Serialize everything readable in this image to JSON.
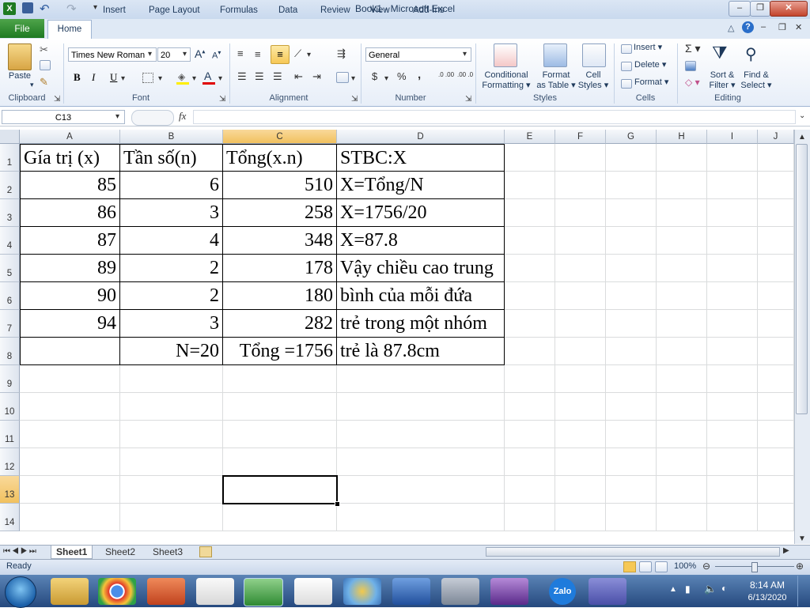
{
  "window": {
    "title": "Book1  -  Microsoft Excel"
  },
  "quick_access": {
    "undo_label": "↶",
    "redo_label": "↷"
  },
  "tabs": [
    "Home",
    "Insert",
    "Page Layout",
    "Formulas",
    "Data",
    "Review",
    "View",
    "Add-Ins"
  ],
  "file_tab": "File",
  "ribbon": {
    "clipboard": {
      "label": "Clipboard",
      "paste": "Paste"
    },
    "font": {
      "label": "Font",
      "name": "Times New Roman",
      "size": "20",
      "bold": "B",
      "italic": "I",
      "underline": "U"
    },
    "alignment": {
      "label": "Alignment"
    },
    "number": {
      "label": "Number",
      "format": "General",
      "currency": "$",
      "percent": "%",
      "comma": ",",
      "inc_decimal": ".0 .00",
      "dec_decimal": ".00 .0"
    },
    "styles": {
      "label": "Styles",
      "conditional": "Conditional\nFormatting",
      "conditional_1": "Conditional",
      "conditional_2": "Formatting",
      "format_table_1": "Format",
      "format_table_2": "as Table",
      "cell_styles_1": "Cell",
      "cell_styles_2": "Styles"
    },
    "cells": {
      "label": "Cells",
      "insert": "Insert",
      "delete": "Delete",
      "format": "Format"
    },
    "editing": {
      "label": "Editing",
      "sort_1": "Sort &",
      "sort_2": "Filter",
      "find_1": "Find &",
      "find_2": "Select"
    }
  },
  "formula_bar": {
    "name_box": "C13",
    "fx": "fx",
    "content": ""
  },
  "columns": [
    "A",
    "B",
    "C",
    "D",
    "E",
    "F",
    "G",
    "H",
    "I",
    "J"
  ],
  "rows": [
    "1",
    "2",
    "3",
    "4",
    "5",
    "6",
    "7",
    "8",
    "9",
    "10",
    "11",
    "12",
    "13",
    "14"
  ],
  "sheet": {
    "r1": [
      "Gía trị (x)",
      "Tần số(n)",
      "Tổng(x.n)",
      "STBC:X"
    ],
    "r2": [
      "85",
      "6",
      "510",
      "X=Tổng/N"
    ],
    "r3": [
      "86",
      "3",
      "258",
      "X=1756/20"
    ],
    "r4": [
      "87",
      "4",
      "348",
      "X=87.8"
    ],
    "r5": [
      "89",
      "2",
      "178",
      "Vậy chiều cao trung"
    ],
    "r6": [
      "90",
      "2",
      "180",
      "bình của mỗi đứa"
    ],
    "r7": [
      "94",
      "3",
      "282",
      "trẻ trong một nhóm"
    ],
    "r8": [
      "",
      "N=20",
      "Tổng =1756",
      "trẻ là 87.8cm"
    ]
  },
  "sheet_tabs": [
    "Sheet1",
    "Sheet2",
    "Sheet3"
  ],
  "status": {
    "text": "Ready",
    "zoom": "100%"
  },
  "taskbar": {
    "time": "8:14 AM",
    "date": "6/13/2020",
    "zalo": "Zalo"
  },
  "colors": {
    "excel_green": "#1e7a22",
    "selection": "#f1c15f",
    "taskbar": "#25497e"
  }
}
